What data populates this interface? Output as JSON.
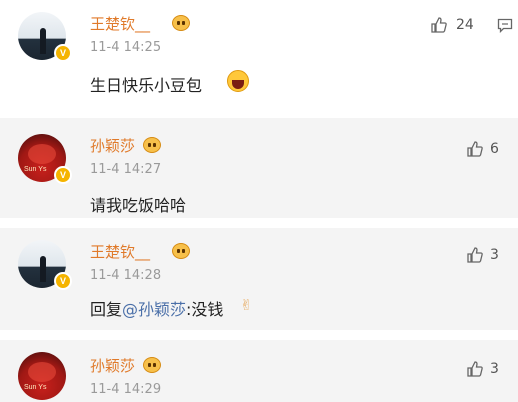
{
  "comments": [
    {
      "name": "王楚钦__",
      "time": "11-4 14:25",
      "text": "生日快乐小豆包",
      "likes": "24"
    },
    {
      "name": "孙颖莎",
      "time": "11-4 14:27",
      "text": "请我吃饭哈哈",
      "likes": "6"
    },
    {
      "name": "王楚钦__",
      "time": "11-4 14:28",
      "reply_prefix": "回复",
      "mention": "@孙颖莎",
      "text": ":没钱",
      "likes": "3"
    },
    {
      "name": "孙颖莎",
      "time": "11-4 14:29",
      "likes": "3"
    }
  ],
  "icons": {
    "like": "thumbs-up-icon",
    "comment": "comment-icon",
    "verified": "verified-badge-icon",
    "crown": "crown-emoji-icon"
  },
  "colors": {
    "name": "#e07a2a",
    "mention": "#4a6fa8",
    "reply_background": "#f4f4f4",
    "verified": "#f5b400"
  }
}
